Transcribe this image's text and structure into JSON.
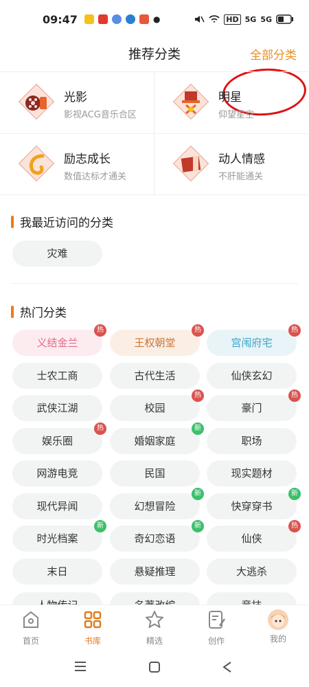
{
  "status": {
    "time": "09:47",
    "tags": "HD",
    "net1": "5G",
    "net2": "5G"
  },
  "header": {
    "title": "推荐分类",
    "all_label": "全部分类"
  },
  "featured": [
    {
      "name": "光影",
      "sub": "影视ACG音乐合区"
    },
    {
      "name": "明星",
      "sub": "仰望星空"
    },
    {
      "name": "励志成长",
      "sub": "数值达标才通关"
    },
    {
      "name": "动人情感",
      "sub": "不肝能通关"
    }
  ],
  "recent": {
    "title": "我最近访问的分类",
    "items": [
      "灾难"
    ]
  },
  "hot": {
    "title": "热门分类",
    "badge_hot": "热",
    "badge_new": "新",
    "items": [
      {
        "label": "义结金兰",
        "badge": "hot",
        "color": "#e06b8b",
        "bg": "#fdecef"
      },
      {
        "label": "王权朝堂",
        "badge": "hot",
        "color": "#c9773a",
        "bg": "#fbeee4"
      },
      {
        "label": "宫闱府宅",
        "badge": "hot",
        "color": "#3aa5c9",
        "bg": "#e8f4f8"
      },
      {
        "label": "士农工商",
        "badge": ""
      },
      {
        "label": "古代生活",
        "badge": ""
      },
      {
        "label": "仙侠玄幻",
        "badge": ""
      },
      {
        "label": "武侠江湖",
        "badge": ""
      },
      {
        "label": "校园",
        "badge": "hot"
      },
      {
        "label": "豪门",
        "badge": "hot"
      },
      {
        "label": "娱乐圈",
        "badge": "hot"
      },
      {
        "label": "婚姻家庭",
        "badge": "new"
      },
      {
        "label": "职场",
        "badge": ""
      },
      {
        "label": "网游电竞",
        "badge": ""
      },
      {
        "label": "民国",
        "badge": ""
      },
      {
        "label": "现实题材",
        "badge": ""
      },
      {
        "label": "现代异闻",
        "badge": ""
      },
      {
        "label": "幻想冒险",
        "badge": "new"
      },
      {
        "label": "快穿穿书",
        "badge": "new"
      },
      {
        "label": "时光档案",
        "badge": "new"
      },
      {
        "label": "奇幻恋语",
        "badge": "new"
      },
      {
        "label": "仙侠",
        "badge": "hot"
      },
      {
        "label": "末日",
        "badge": ""
      },
      {
        "label": "悬疑推理",
        "badge": ""
      },
      {
        "label": "大逃杀",
        "badge": ""
      }
    ],
    "partial": [
      "人物传记",
      "名著改编",
      "竞技"
    ]
  },
  "tabs": [
    {
      "label": "首页",
      "icon": "home-icon"
    },
    {
      "label": "书库",
      "icon": "library-icon"
    },
    {
      "label": "精选",
      "icon": "star-icon"
    },
    {
      "label": "创作",
      "icon": "edit-icon"
    },
    {
      "label": "我的",
      "icon": "avatar"
    }
  ],
  "accent": "#e8901d"
}
